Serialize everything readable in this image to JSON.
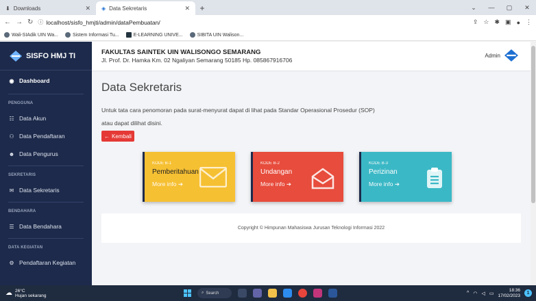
{
  "browser": {
    "tabs": [
      {
        "label": "Downloads",
        "active": false
      },
      {
        "label": "Data Sekretaris",
        "active": true
      }
    ],
    "url": "localhost/sisfo_hmjti/admin/dataPembuatan/",
    "bookmarks": [
      "Wali-SIAdik UIN Wa...",
      "Sistem Informasi Tu...",
      "E-LEARNING UNIVE...",
      "SIBITA UIN Walison..."
    ]
  },
  "sidebar": {
    "brand": "SISFO HMJ TI",
    "dashboard": "Dashboard",
    "sections": {
      "pengguna": "PENGGUNA",
      "sekretaris": "SEKRETARIS",
      "bendahara": "BENDAHARA",
      "kegiatan": "DATA KEGIATAN"
    },
    "items": {
      "akun": "Data Akun",
      "pendaftaran": "Data Pendaftaran",
      "pengurus": "Data Pengurus",
      "sekretaris": "Data Sekretaris",
      "bendahara": "Data Bendahara",
      "pendaftaran_kegiatan": "Pendaftaran Kegiatan"
    }
  },
  "header": {
    "faculty": "FAKULTAS SAINTEK UIN WALISONGO SEMARANG",
    "address": "Jl. Prof. Dr. Hamka Km. 02 Ngaliyan Semarang 50185 Hp. 085867916706",
    "user": "Admin"
  },
  "main": {
    "title": "Data Sekretaris",
    "description_1": "Untuk tata cara penomoran pada surat-menyurat dapat di lihat pada Standar Operasional Prosedur (SOP)",
    "description_2": "atau dapat dilihat disini.",
    "back_button": "Kembali",
    "cards": [
      {
        "code": "KODE B-1",
        "label": "Pemberitahuan",
        "more": "More info",
        "color": "#f6c033"
      },
      {
        "code": "KODE B-2",
        "label": "Undangan",
        "more": "More info",
        "color": "#e74c3c"
      },
      {
        "code": "KODE B-3",
        "label": "Perizinan",
        "more": "More info",
        "color": "#3bb8c6"
      }
    ],
    "footer": "Copyright © Himpunan Mahasiswa Jurusan Teknologi Informasi 2022"
  },
  "taskbar": {
    "temperature": "26°C",
    "weather": "Hujan sekarang",
    "search": "Search",
    "time": "18:36",
    "date": "17/02/2023"
  },
  "colors": {
    "sidebar": "#1d2a4b",
    "danger": "#e53935",
    "warning": "#f6c033",
    "info": "#3bb8c6"
  }
}
